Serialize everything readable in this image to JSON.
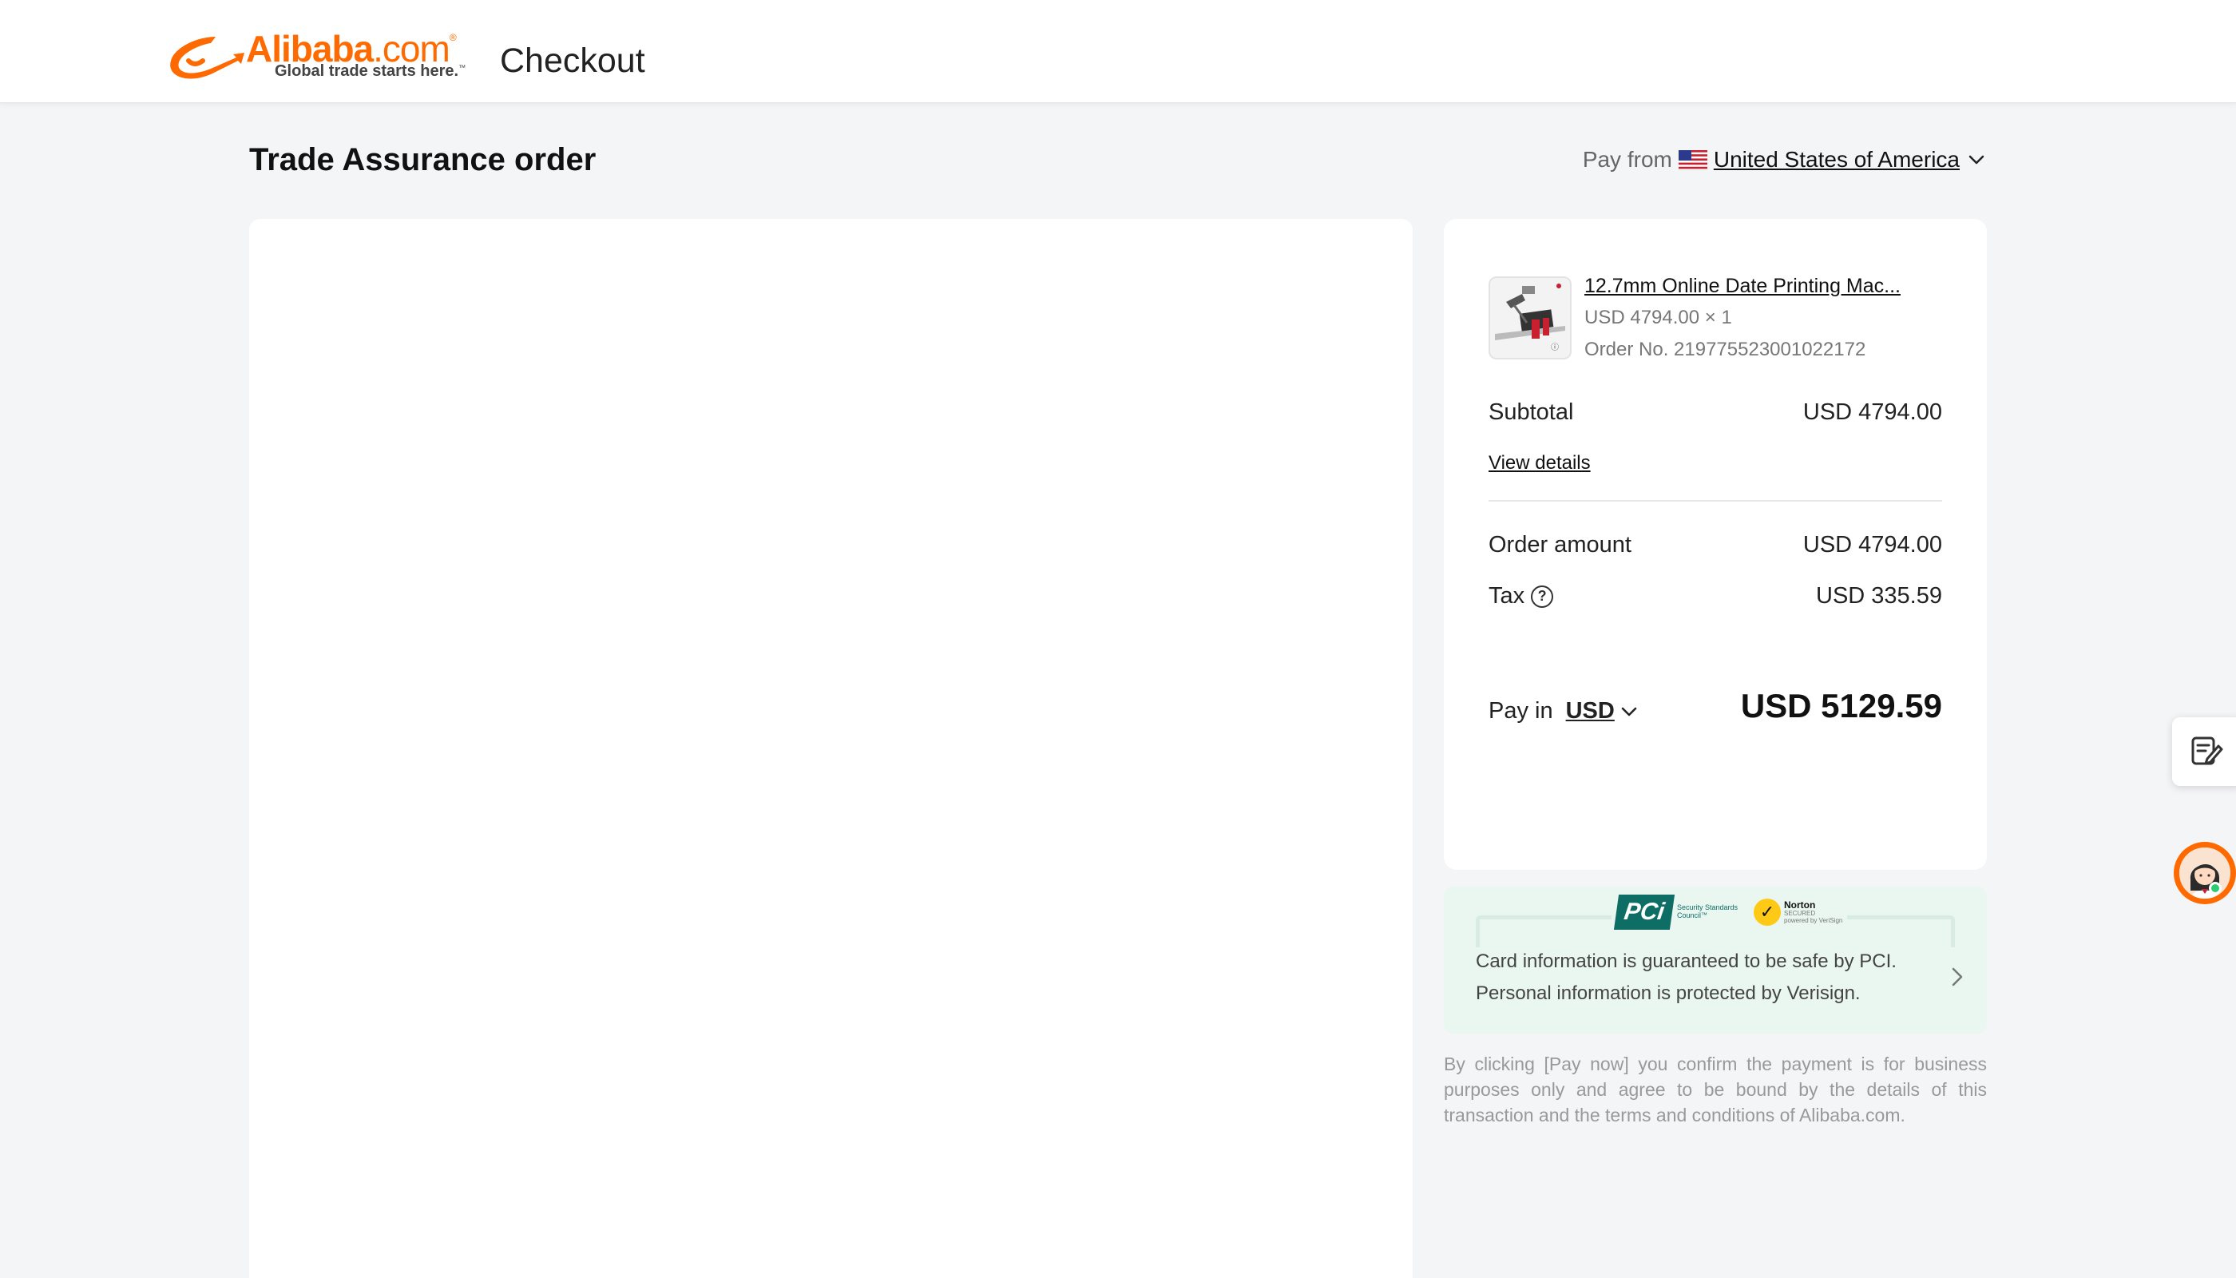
{
  "header": {
    "logo_word": "Alibaba",
    "logo_dotcom": ".com",
    "logo_registered": "®",
    "logo_tagline": "Global trade starts here.",
    "logo_tm": "™",
    "title": "Checkout"
  },
  "page": {
    "title": "Trade Assurance order",
    "pay_from_label": "Pay from",
    "pay_from_country": "United States of America"
  },
  "order": {
    "product_name": "12.7mm Online Date Printing Mac...",
    "product_price": "USD 4794.00 × 1",
    "order_number": "Order No. 219775523001022172",
    "subtotal_label": "Subtotal",
    "subtotal_value": "USD 4794.00",
    "view_details": "View details",
    "order_amount_label": "Order amount",
    "order_amount_value": "USD 4794.00",
    "tax_label": "Tax",
    "tax_value": "USD 335.59",
    "pay_in_label": "Pay in",
    "pay_in_currency": "USD",
    "total": "USD 5129.59"
  },
  "security": {
    "pci_mark": "PCi",
    "pci_text": "Security Standards Council",
    "pci_tm": "™",
    "norton_name": "Norton",
    "norton_secured": "SECURED",
    "norton_powered": "powered by VeriSign",
    "line1": "Card information is guaranteed to be safe by PCI.",
    "line2": "Personal information is protected by Verisign."
  },
  "disclaimer": "By clicking [Pay now] you confirm the payment is for business purposes only and agree to be bound by the details of this transaction and the terms and conditions of Alibaba.com.",
  "colors": {
    "brand_orange": "#ff6a00",
    "security_bg": "#e9f7f0",
    "pci_green": "#0e6e66",
    "online_green": "#2ecc71"
  },
  "icons": {
    "logo": "alibaba-smile-icon",
    "flag": "us-flag-icon",
    "chevron": "chevron-down-icon",
    "help": "question-circle-icon",
    "arrow": "chevron-right-icon",
    "feedback": "feedback-form-icon",
    "assistant": "customer-service-avatar-icon"
  }
}
